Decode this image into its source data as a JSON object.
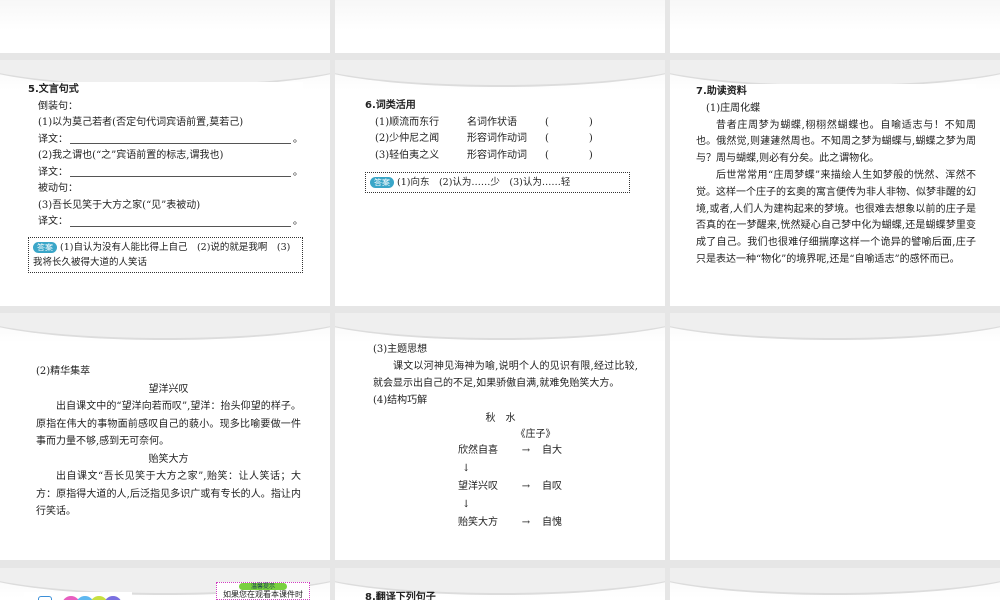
{
  "slide5": {
    "title": "5.文言句式",
    "l1": "倒装句：",
    "l2": "(1)以为莫己若者(否定句代词宾语前置,莫若己)",
    "tr": "译文：",
    "l3": "(2)我之谓也(“之”宾语前置的标志,谓我也)",
    "l4": "被动句：",
    "l5": "(3)吾长见笑于大方之家(“见”表被动)",
    "answer_tag": "答案",
    "answer": "(1)自认为没有人能比得上自己　(2)说的就是我啊　(3)我将长久被得大道的人笑话"
  },
  "slide6": {
    "title": "6.词类活用",
    "items": [
      {
        "a": "(1)顺流而东行",
        "b": "名词作状语",
        "c": "(　　　　)"
      },
      {
        "a": "(2)少仲尼之闻",
        "b": "形容词作动词",
        "c": "(　　　　)"
      },
      {
        "a": "(3)轻伯夷之义",
        "b": "形容词作动词",
        "c": "(　　　　)"
      }
    ],
    "answer_tag": "答案",
    "answer": "(1)向东　(2)认为……少　(3)认为……轻"
  },
  "slide7": {
    "title": "7.助读资料",
    "sub": "(1)庄周化蝶",
    "p1": "昔者庄周梦为蝴蝶,栩栩然蝴蝶也。自喻适志与！不知周也。俄然觉,则蘧蘧然周也。不知周之梦为蝴蝶与,蝴蝶之梦为周与？周与蝴蝶,则必有分矣。此之谓物化。",
    "p2": "后世常常用“庄周梦蝶”来描绘人生如梦般的恍然、浑然不觉。这样一个庄子的玄奥的寓言便传为非人非物、似梦非醒的幻境,或者,人们人为建构起来的梦境。也很难去想象以前的庄子是否真的在一梦醒来,恍然疑心自己梦中化为蝴蝶,还是蝴蝶梦里变成了自己。我们也很难仔细揣摩这样一个诡异的譬喻后面,庄子只是表达一种“物化”的境界呢,还是“自喻适志”的感怀而已。"
  },
  "slide_jinghua": {
    "sub": "(2)精华集萃",
    "h1": "望洋兴叹",
    "p1": "出自课文中的“望洋向若而叹”,望洋：抬头仰望的样子。原指在伟大的事物面前感叹自己的藐小。现多比喻要做一件事而力量不够,感到无可奈何。",
    "h2": "贻笑大方",
    "p2": "出自课文“吾长见笑于大方之家”,贻笑：让人笑话；大方：原指得大道的人,后泛指见多识广或有专长的人。指让内行笑话。"
  },
  "slide_theme": {
    "sub3": "(3)主题思想",
    "p": "课文以河神见海神为喻,说明个人的见识有限,经过比较,就会显示出自己的不足,如果骄傲自满,就难免贻笑大方。",
    "sub4": "(4)结构巧解",
    "t1": "秋　水",
    "t2": "《庄子》",
    "flow": [
      {
        "a": "欣然自喜",
        "b": "自大"
      },
      {
        "a": "望洋兴叹",
        "b": "自叹"
      },
      {
        "a": "贻笑大方",
        "b": "自愧"
      }
    ],
    "arrow_right": "→",
    "arrow_down": "↓"
  },
  "bottom": {
    "tip_title": "温馨提示",
    "tip_text": "如果您在观看本课件时",
    "next_title": "8.翻译下列句子"
  },
  "colors": {
    "circles": [
      "#3b8fd8",
      "#e85fc0",
      "#5fb8f0",
      "#c8e040",
      "#7a70e0"
    ]
  }
}
